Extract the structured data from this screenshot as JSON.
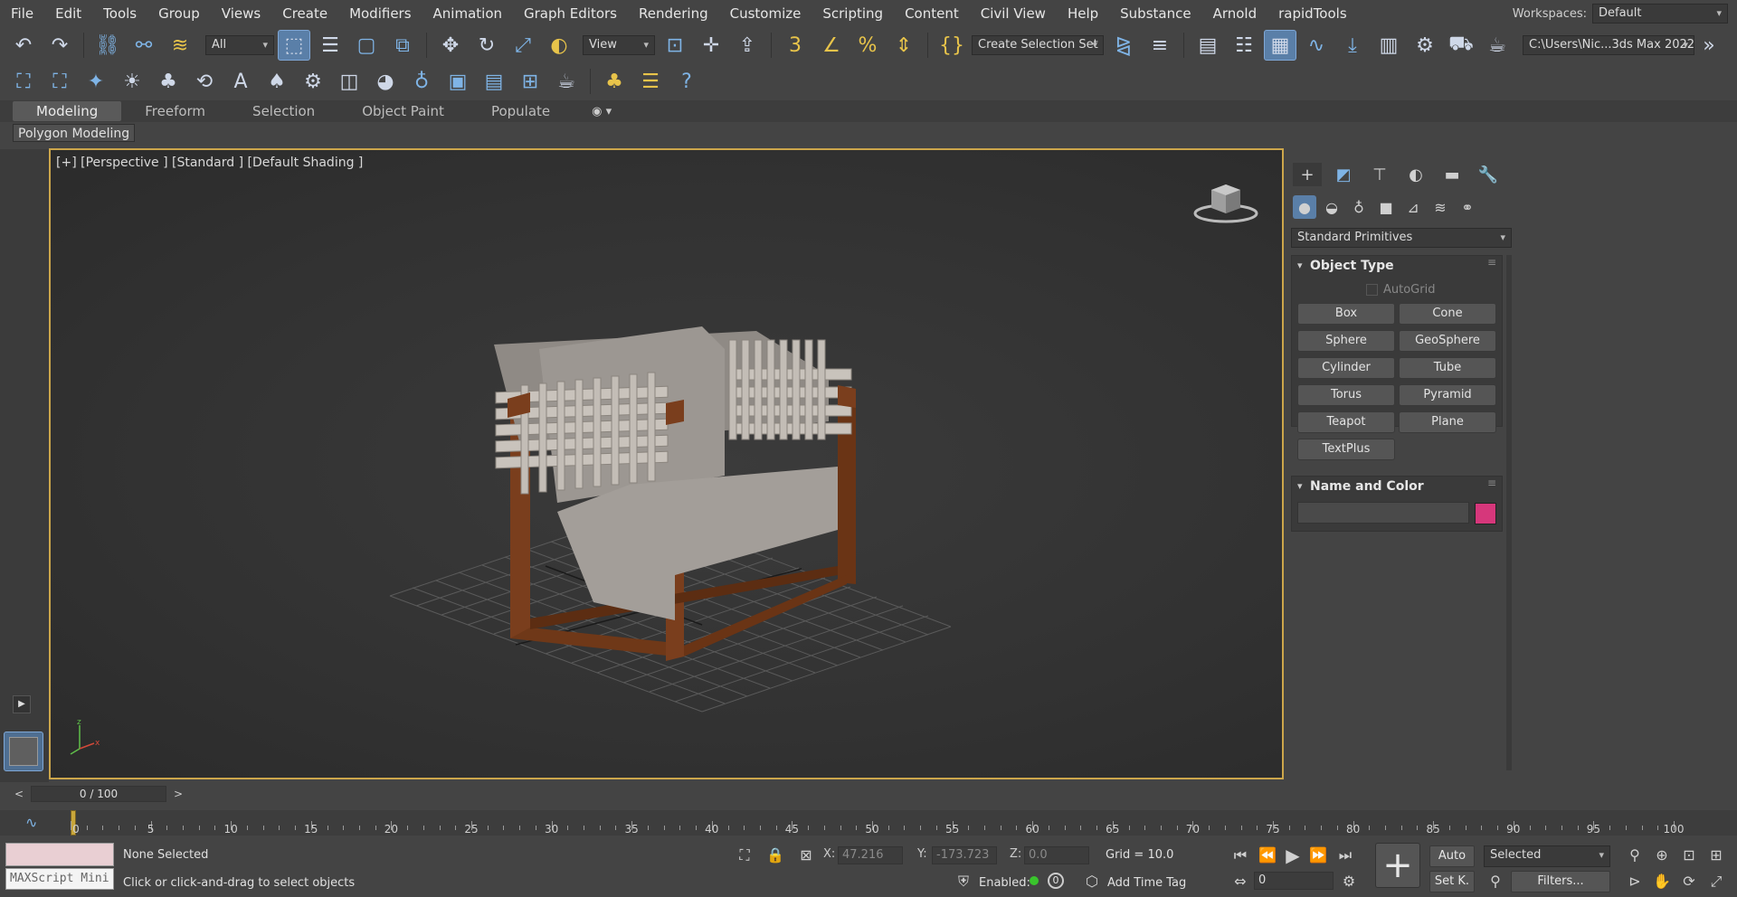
{
  "menubar": {
    "items": [
      "File",
      "Edit",
      "Tools",
      "Group",
      "Views",
      "Create",
      "Modifiers",
      "Animation",
      "Graph Editors",
      "Rendering",
      "Customize",
      "Scripting",
      "Content",
      "Civil View",
      "Help",
      "Substance",
      "Arnold",
      "rapidTools"
    ],
    "workspaces_label": "Workspaces:",
    "workspaces_value": "Default"
  },
  "toolbar": {
    "filter_value": "All",
    "refcoord_value": "View",
    "selection_set_value": "Create Selection Set",
    "project_path": "C:\\Users\\Nic...3ds Max 2022"
  },
  "ribbon": {
    "tabs": [
      "Modeling",
      "Freeform",
      "Selection",
      "Object Paint",
      "Populate"
    ],
    "active_tab": "Modeling",
    "panel_label": "Polygon Modeling"
  },
  "viewport": {
    "label": "[+] [Perspective ] [Standard ] [Default Shading ]",
    "border_color": "#cca64b"
  },
  "command_panel": {
    "category_value": "Standard Primitives",
    "object_type": {
      "title": "Object Type",
      "autogrid_label": "AutoGrid",
      "buttons": [
        "Box",
        "Cone",
        "Sphere",
        "GeoSphere",
        "Cylinder",
        "Tube",
        "Torus",
        "Pyramid",
        "Teapot",
        "Plane",
        "TextPlus"
      ]
    },
    "name_and_color": {
      "title": "Name and Color",
      "name_value": "",
      "color": "#d6377b"
    }
  },
  "timeslider": {
    "position": "0 / 100",
    "prev": "<",
    "next": ">"
  },
  "trackbar": {
    "ticks": [
      "0",
      "5",
      "10",
      "15",
      "20",
      "25",
      "30",
      "35",
      "40",
      "45",
      "50",
      "55",
      "60",
      "65",
      "70",
      "75",
      "80",
      "85",
      "90",
      "95",
      "100"
    ]
  },
  "status": {
    "maxscript_label": "MAXScript Mini",
    "selection_text": "None Selected",
    "prompt_text": "Click or click-and-drag to select objects",
    "x_label": "X:",
    "x_value": "47.216",
    "y_label": "Y:",
    "y_value": "-173.723",
    "z_label": "Z:",
    "z_value": "0.0",
    "grid_text": "Grid = 10.0",
    "enabled_label": "Enabled:",
    "key_count": "0",
    "add_time_tag": "Add Time Tag",
    "auto_label": "Auto",
    "setkey_label": "Set K.",
    "selected_value": "Selected",
    "filters_label": "Filters...",
    "frame_value": "0"
  }
}
